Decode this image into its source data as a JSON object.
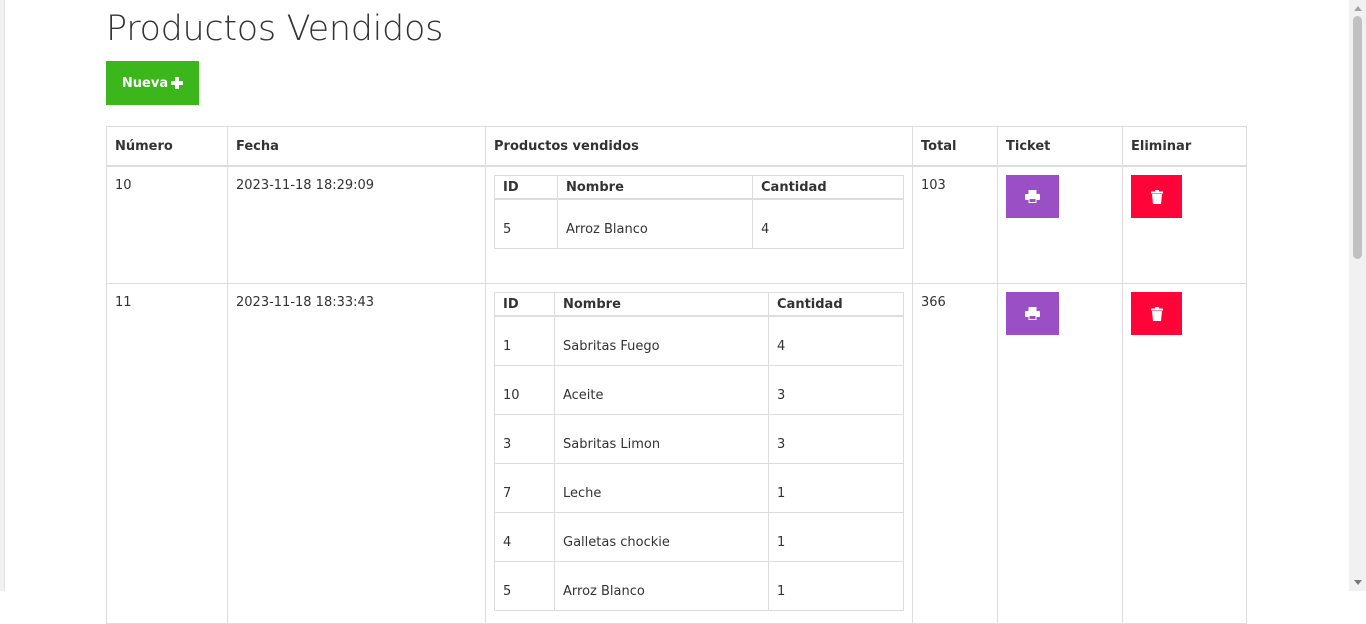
{
  "page": {
    "title": "Productos Vendidos",
    "new_button": "Nueva"
  },
  "table": {
    "headers": [
      "Número",
      "Fecha",
      "Productos vendidos",
      "Total",
      "Ticket",
      "Eliminar"
    ],
    "inner_headers": [
      "ID",
      "Nombre",
      "Cantidad"
    ],
    "rows": [
      {
        "numero": "10",
        "fecha": "2023-11-18 18:29:09",
        "total": "103",
        "productos": [
          {
            "id": "5",
            "nombre": "Arroz Blanco",
            "cantidad": "4"
          }
        ]
      },
      {
        "numero": "11",
        "fecha": "2023-11-18 18:33:43",
        "total": "366",
        "productos": [
          {
            "id": "1",
            "nombre": "Sabritas Fuego",
            "cantidad": "4"
          },
          {
            "id": "10",
            "nombre": "Aceite",
            "cantidad": "3"
          },
          {
            "id": "3",
            "nombre": "Sabritas Limon",
            "cantidad": "3"
          },
          {
            "id": "7",
            "nombre": "Leche",
            "cantidad": "1"
          },
          {
            "id": "4",
            "nombre": "Galletas chockie",
            "cantidad": "1"
          },
          {
            "id": "5",
            "nombre": "Arroz Blanco",
            "cantidad": "1"
          }
        ]
      }
    ]
  },
  "icons": {
    "new": "plus-icon",
    "ticket": "print-icon",
    "delete": "trash-icon"
  },
  "colors": {
    "new_button": "#3bb71b",
    "ticket_button": "#9b4fc4",
    "delete_button": "#ff0439"
  }
}
